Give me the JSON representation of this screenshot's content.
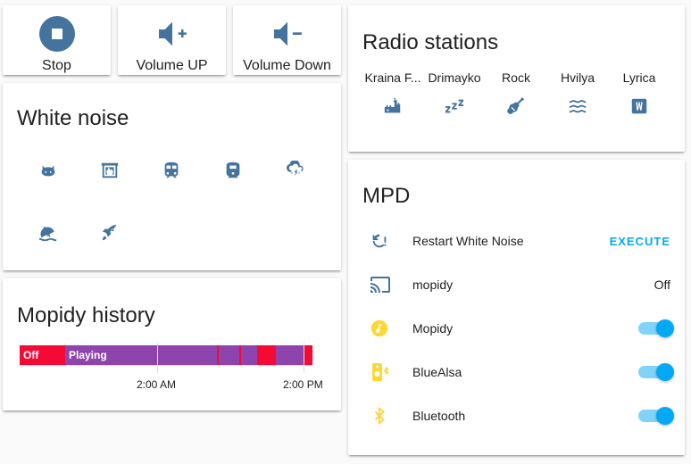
{
  "buttons": {
    "stop": "Stop",
    "volume_up": "Volume UP",
    "volume_down": "Volume Down"
  },
  "white_noise": {
    "title": "White noise",
    "icons": [
      "cat-icon",
      "fireplace-icon",
      "train-icon",
      "train-variant-icon",
      "weather-pouring-icon",
      "beach-icon",
      "rocket-icon"
    ]
  },
  "history": {
    "title": "Mopidy history",
    "states": {
      "off": "Off",
      "playing": "Playing"
    },
    "axis": [
      "2:00 AM",
      "2:00 PM"
    ],
    "colors": {
      "off": "#f50a36",
      "playing": "#8e44ad"
    }
  },
  "radio": {
    "title": "Radio stations",
    "stations": [
      {
        "label": "Kraina F...",
        "icon": "castle-icon"
      },
      {
        "label": "Drimayko",
        "icon": "sleep-icon"
      },
      {
        "label": "Rock",
        "icon": "guitar-icon"
      },
      {
        "label": "Hvilya",
        "icon": "waves-icon"
      },
      {
        "label": "Lyrica",
        "icon": "alpha-w-box-icon"
      }
    ]
  },
  "mpd": {
    "title": "MPD",
    "rows": [
      {
        "name": "Restart White Noise",
        "state": "EXECUTE"
      },
      {
        "name": "mopidy",
        "state": "Off"
      },
      {
        "name": "Mopidy",
        "state": "on"
      },
      {
        "name": "BlueAlsa",
        "state": "on"
      },
      {
        "name": "Bluetooth",
        "state": "on"
      }
    ]
  },
  "colors": {
    "icon": "#44739e",
    "accent": "#03a9f4",
    "active_icon": "#fdd835"
  }
}
